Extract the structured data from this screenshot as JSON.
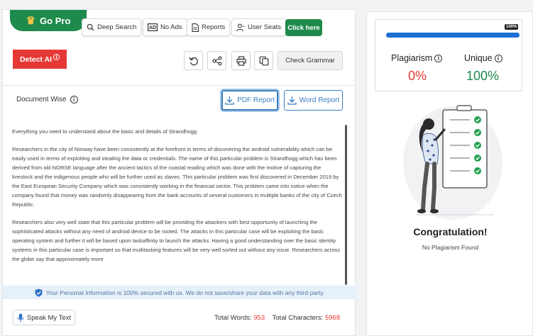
{
  "toolbar": {
    "gopro_label": "Go Pro",
    "buttons": [
      {
        "label": "Deep Search",
        "icon": "search-icon"
      },
      {
        "label": "No Ads",
        "icon": "no-ads-icon"
      },
      {
        "label": "Reports",
        "icon": "document-icon"
      },
      {
        "label": "User Seats",
        "icon": "users-icon"
      }
    ],
    "click_here_label": "Click here"
  },
  "actions": {
    "detect_ai_label": "Detect AI",
    "detect_ai_info": "i",
    "icons": [
      "undo-icon",
      "share-icon",
      "print-icon",
      "copy-icon"
    ],
    "check_grammar_label": "Check Grammar"
  },
  "document": {
    "title": "Document Wise",
    "info": "i",
    "pdf_report_label": "PDF Report",
    "word_report_label": "Word Report",
    "paragraphs": [
      "Everything you need to understand about the basic and details of Strandhogg",
      "Researchers in the city of Norway have been consistently at the forefront in terms of discovering the android vulnerability which can be easily used in terms of exploiting and stealing the data or credentials. The name of this particular problem is Strandhogg which has been derived from old NORSE language after the ancient tactics of the coastal reading which was done with the motive of capturing the livestock and the indigenous people who will be further used as slaves. This particular problem was first discovered in December 2019 by the East European Security Company which was consistently working in the financial sector. This problem came into notice when the company found that money was randomly disappearing from the bank accounts of several customers in multiple banks of the city of Czech Republic.",
      "Researchers also very well state that this particular problem will be providing the attackers with best opportunity of launching the sophisticated attacks without any need of android device to be rooted. The attacks in this particular case will be exploiting the basic operating system and further it will be based upon taskaffinity to launch the attacks. Having a good understanding over the basic identity systems in this particular case is important so that multitasking features will be very well sorted out without any issue. Researchers across the globe say that approximately more"
    ],
    "secure_notice": "Your Personal Information is 100% secured with us. We do not save/share your data with any third party.",
    "speak_label": "Speak My Text",
    "total_words_label": "Total Words:",
    "total_words": "953",
    "total_chars_label": "Total Characters:",
    "total_chars": "5968"
  },
  "results": {
    "progress_percent": 100,
    "progress_label": "100%",
    "plagiarism_label": "Plagiarism",
    "plagiarism_value": "0%",
    "unique_label": "Unique",
    "unique_value": "100%",
    "info": "i",
    "congrats_title": "Congratulation!",
    "congrats_sub": "No Plagiarism Found"
  },
  "colors": {
    "brand_green": "#1e8a4c",
    "alert_red": "#e53935",
    "accent_blue": "#3d7fc1",
    "progress_blue": "#1a6fd1"
  }
}
